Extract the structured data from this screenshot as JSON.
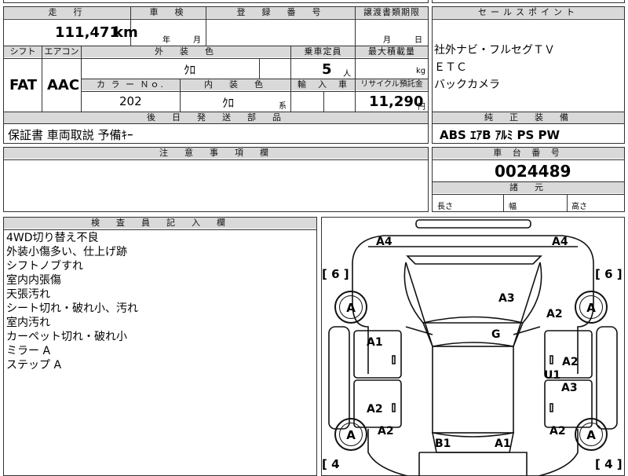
{
  "mileage": {
    "header": "走　行",
    "value": "111,471",
    "unit": "km"
  },
  "inspection": {
    "header": "車　検",
    "year_label": "年",
    "month_label": "月"
  },
  "registration": {
    "header": "登　録　番　号"
  },
  "transfer_deadline": {
    "header": "譲渡書類期限",
    "month_label": "月",
    "day_label": "日"
  },
  "shift": {
    "header": "シフト",
    "value": "FAT"
  },
  "aircon": {
    "header": "エアコン",
    "value": "AAC"
  },
  "exterior_color": {
    "header": "外　装　色",
    "value": "ｸﾛ"
  },
  "capacity": {
    "header": "乗車定員",
    "value": "5",
    "unit": "人"
  },
  "max_load": {
    "header": "最大積載量",
    "unit": "kg"
  },
  "color_no": {
    "header": "カ ラ ー Ｎｏ.",
    "value": "202"
  },
  "interior_color": {
    "header": "内　装　色",
    "value": "ｸﾛ",
    "suffix": "系"
  },
  "import": {
    "header": "輸　入　車"
  },
  "recycle": {
    "header": "リサイクル預託金",
    "value": "11,290",
    "unit": "円"
  },
  "later_items": {
    "header": "後　日　発　送　部　品",
    "value": "保証書 車両取説 予備ｷｰ"
  },
  "sales_points": {
    "header": "セールスポイント",
    "items": [
      "社外ナビ・フルセグＴＶ",
      "ＥＴＣ",
      "バックカメラ"
    ]
  },
  "equipment": {
    "header": "純　正　装　備",
    "value": "ABS ｴｱB ｱﾙﾐ PS PW"
  },
  "notes": {
    "header": "注　意　事　項　欄"
  },
  "chassis": {
    "header": "車 台 番 号",
    "value": "0024489"
  },
  "dimensions": {
    "header": "諸　元",
    "length": "長さ",
    "width": "幅",
    "height": "高さ"
  },
  "inspector": {
    "header": "検　査　員　記　入　欄",
    "lines": [
      "4WD切り替え不良",
      "外装小傷多い、仕上げ跡",
      "シフトノブすれ",
      "室内内張傷",
      "天張汚れ",
      "シート切れ・破れ小、汚れ",
      "室内汚れ",
      "カーペット切れ・破れ小",
      "ミラー A",
      "ステップ A"
    ]
  },
  "diagram": {
    "tire_counts": {
      "front_left": "[ 6 ]",
      "front_right": "[ 6 ]",
      "rear_left": "[ 4",
      "rear_right": "[ 4 ]"
    },
    "tire_labels": {
      "fl": "A",
      "fr": "A",
      "rl": "A",
      "rr": "A"
    },
    "marks": {
      "a4_left": "A4",
      "a4_right": "A4",
      "a3_hood": "A3",
      "a2_fender": "A2",
      "g_windshield": "G",
      "a1_door_l": "A1",
      "a2_door_r": "A2",
      "u1": "U1",
      "a3_door_r": "A3",
      "a2_rear_l": "A2",
      "a2_quarter_l": "A2",
      "a2_quarter_r": "A2",
      "b1": "B1",
      "a1_rear": "A1"
    }
  }
}
